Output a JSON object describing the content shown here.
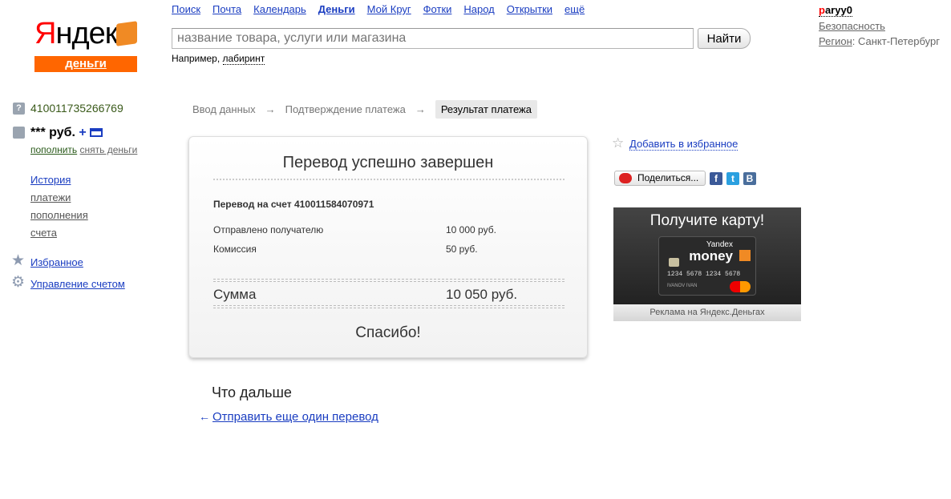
{
  "logo": {
    "text": "Яндекс",
    "sub": "деньги"
  },
  "nav": [
    "Поиск",
    "Почта",
    "Календарь",
    "Деньги",
    "Мой Круг",
    "Фотки",
    "Народ",
    "Открытки",
    "ещё"
  ],
  "search": {
    "placeholder": "название товара, услуги или магазина",
    "button": "Найти",
    "example_prefix": "Например,",
    "example_link": "лабиринт"
  },
  "user": {
    "first": "p",
    "rest": "aryy0",
    "security": "Безопасность",
    "region_label": "Регион",
    "region_value": ": Санкт-Петербург"
  },
  "account": {
    "number": "410011735266769",
    "balance": "*** руб.",
    "plus": "+",
    "topup": "пополнить",
    "withdraw": "снять деньги"
  },
  "sidebar": {
    "history": "История",
    "payments": "платежи",
    "topups": "пополнения",
    "accounts": "счета",
    "favorites": "Избранное",
    "manage": "Управление счетом"
  },
  "breadcrumbs": [
    "Ввод данных",
    "Подтверждение платежа",
    "Результат платежа"
  ],
  "arrow": "→",
  "result": {
    "title": "Перевод успешно завершен",
    "to_account": "Перевод на счет 410011584070971",
    "sent_label": "Отправлено получателю",
    "sent_value": "10 000 руб.",
    "fee_label": "Комиссия",
    "fee_value": "50 руб.",
    "total_label": "Сумма",
    "total_value": "10 050 руб.",
    "thanks": "Спасибо!"
  },
  "next": {
    "title": "Что дальше",
    "link": "Отправить еще один перевод"
  },
  "right": {
    "favorite": "Добавить в избранное",
    "share": "Поделиться...",
    "fb": "f",
    "tw": "t",
    "vk": "B"
  },
  "ad": {
    "title": "Получите карту!",
    "brand1": "Yandex",
    "brand2": "money",
    "card_number": "1234 5678 1234 5678",
    "holder": "IVANOV IVAN",
    "caption": "Реклама на Яндекс.Деньгах"
  }
}
